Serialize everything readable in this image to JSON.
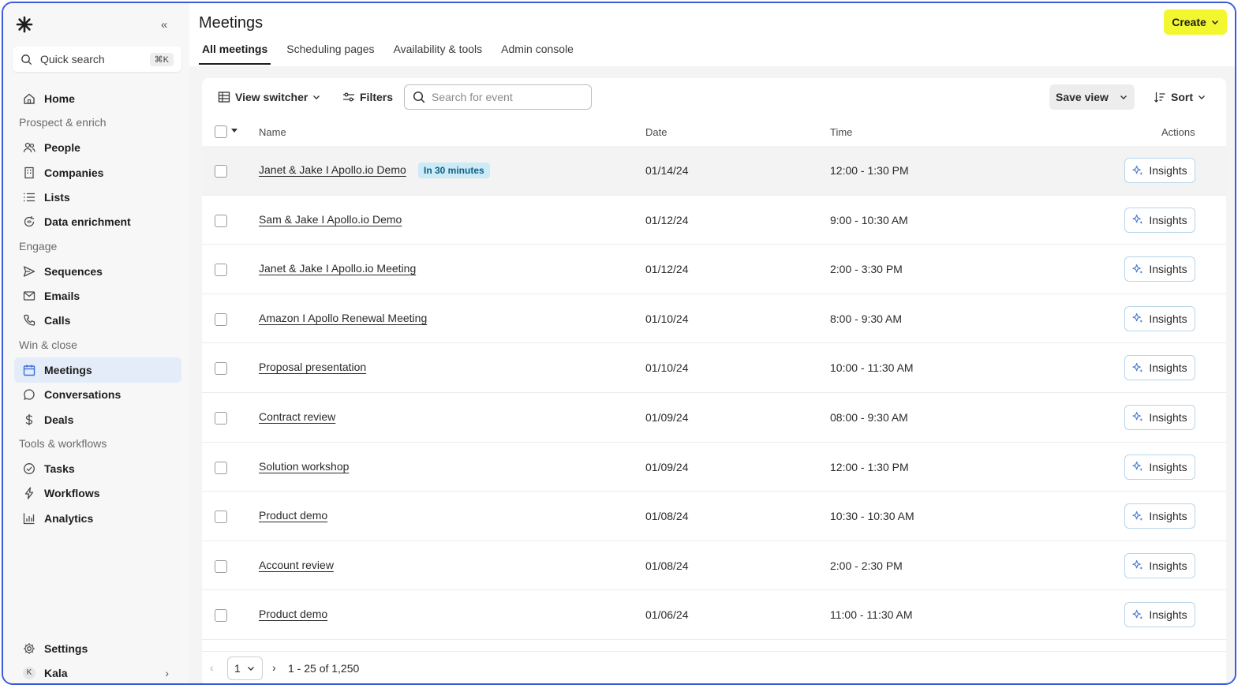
{
  "sidebar": {
    "logo_icon": "asterisk-logo-icon",
    "collapse_icon": "double-chevron-left-icon",
    "quick_search": {
      "label": "Quick search",
      "shortcut": "⌘K"
    },
    "home": "Home",
    "sections": {
      "prospect": "Prospect & enrich",
      "engage": "Engage",
      "win": "Win & close",
      "tools": "Tools & workflows"
    },
    "items": {
      "people": "People",
      "companies": "Companies",
      "lists": "Lists",
      "data_enrichment": "Data enrichment",
      "sequences": "Sequences",
      "emails": "Emails",
      "calls": "Calls",
      "meetings": "Meetings",
      "conversations": "Conversations",
      "deals": "Deals",
      "tasks": "Tasks",
      "workflows": "Workflows",
      "analytics": "Analytics"
    },
    "active_item": "Meetings",
    "settings": "Settings",
    "user": {
      "initial": "K",
      "name": "Kala"
    }
  },
  "header": {
    "title": "Meetings",
    "create_label": "Create",
    "tabs": [
      "All meetings",
      "Scheduling pages",
      "Availability & tools",
      "Admin console"
    ],
    "active_tab": "All meetings"
  },
  "toolbar": {
    "view_switcher": "View switcher",
    "filters": "Filters",
    "search_placeholder": "Search for event",
    "save_view": "Save view",
    "sort": "Sort"
  },
  "table": {
    "columns": {
      "name": "Name",
      "date": "Date",
      "time": "Time",
      "actions": "Actions"
    },
    "action_label": "Insights",
    "rows": [
      {
        "name": "Janet & Jake I Apollo.io Demo",
        "badge": "In 30 minutes",
        "date": "01/14/24",
        "time": "12:00 - 1:30 PM"
      },
      {
        "name": "Sam & Jake I Apollo.io Demo",
        "date": "01/12/24",
        "time": "9:00 - 10:30 AM"
      },
      {
        "name": "Janet & Jake I Apollo.io Meeting",
        "date": "01/12/24",
        "time": "2:00 - 3:30 PM"
      },
      {
        "name": "Amazon I Apollo Renewal Meeting",
        "date": "01/10/24",
        "time": "8:00 - 9:30 AM"
      },
      {
        "name": "Proposal presentation",
        "date": "01/10/24",
        "time": "10:00 - 11:30 AM"
      },
      {
        "name": "Contract review",
        "date": "01/09/24",
        "time": "08:00 - 9:30 AM"
      },
      {
        "name": "Solution workshop",
        "date": "01/09/24",
        "time": "12:00 - 1:30 PM"
      },
      {
        "name": "Product demo",
        "date": "01/08/24",
        "time": "10:30 - 10:30 AM"
      },
      {
        "name": "Account review",
        "date": "01/08/24",
        "time": "2:00 - 2:30 PM"
      },
      {
        "name": "Product demo",
        "date": "01/06/24",
        "time": "11:00 - 11:30 AM"
      }
    ]
  },
  "pagination": {
    "page": "1",
    "range": "1 - 25 of 1,250"
  },
  "colors": {
    "accent": "#3b6fd9",
    "create_button": "#f3f72f",
    "badge_bg": "#cdeaf7",
    "frame_border": "#3b5bdb"
  }
}
